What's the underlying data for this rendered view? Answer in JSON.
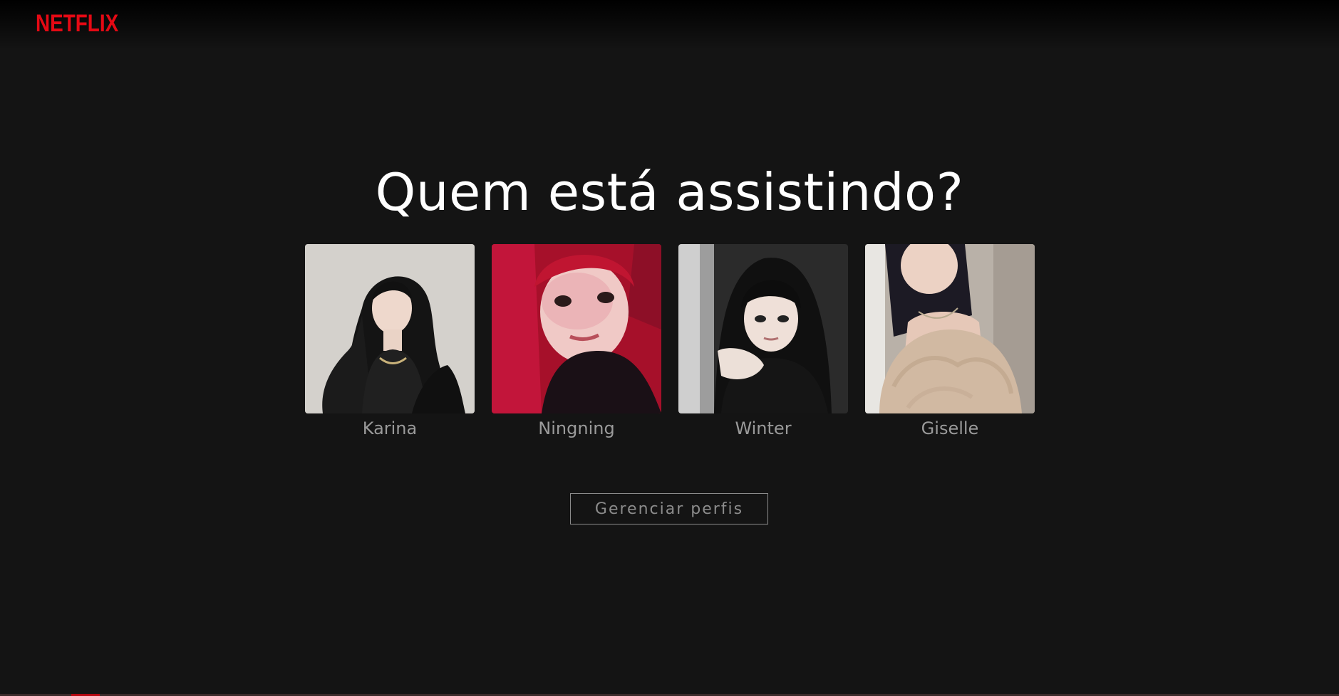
{
  "brand": {
    "logo_text": "NETFLIX",
    "logo_color": "#e50914"
  },
  "page": {
    "title": "Quem está assistindo?",
    "background_color": "#141414"
  },
  "profiles": [
    {
      "name": "Karina",
      "avatar_icon": "profile-photo"
    },
    {
      "name": "Ningning",
      "avatar_icon": "profile-photo"
    },
    {
      "name": "Winter",
      "avatar_icon": "profile-photo"
    },
    {
      "name": "Giselle",
      "avatar_icon": "profile-photo"
    }
  ],
  "actions": {
    "manage_profiles_label": "Gerenciar perfis"
  }
}
